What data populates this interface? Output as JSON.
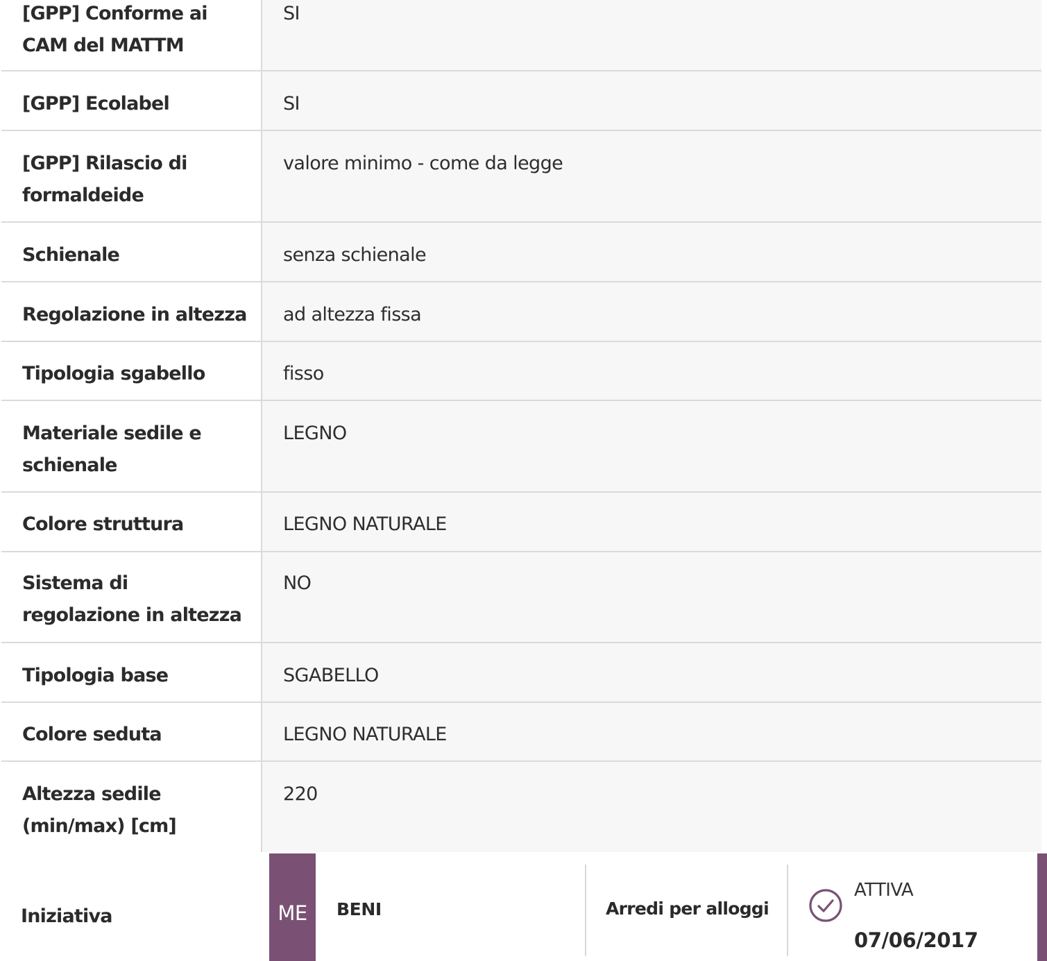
{
  "rows": [
    {
      "label": "[GPP] Conforme ai CAM del MATTM",
      "value": "SI"
    },
    {
      "label": "[GPP] Ecolabel",
      "value": "SI"
    },
    {
      "label": "[GPP] Rilascio di formaldeide",
      "value": "valore minimo - come da legge"
    },
    {
      "label": "Schienale",
      "value": "senza schienale"
    },
    {
      "label": "Regolazione in altezza",
      "value": "ad altezza fissa"
    },
    {
      "label": "Tipologia sgabello",
      "value": "fisso"
    },
    {
      "label": "Materiale sedile e schienale",
      "value": "LEGNO"
    },
    {
      "label": "Colore struttura",
      "value": "LEGNO NATURALE"
    },
    {
      "label": "Sistema di regolazione in altezza",
      "value": "NO"
    },
    {
      "label": "Tipologia base",
      "value": "SGABELLO"
    },
    {
      "label": "Colore seduta",
      "value": "LEGNO NATURALE"
    },
    {
      "label": "Altezza sedile (min/max) [cm]",
      "value": "220"
    }
  ],
  "iniziativa": {
    "label": "Iniziativa",
    "badge": "ME",
    "type": "BENI",
    "category": "Arredi per alloggi",
    "status": "ATTIVA",
    "date": "07/06/2017",
    "status_icon": "check-circle-icon",
    "accent_color": "#7a5174"
  }
}
